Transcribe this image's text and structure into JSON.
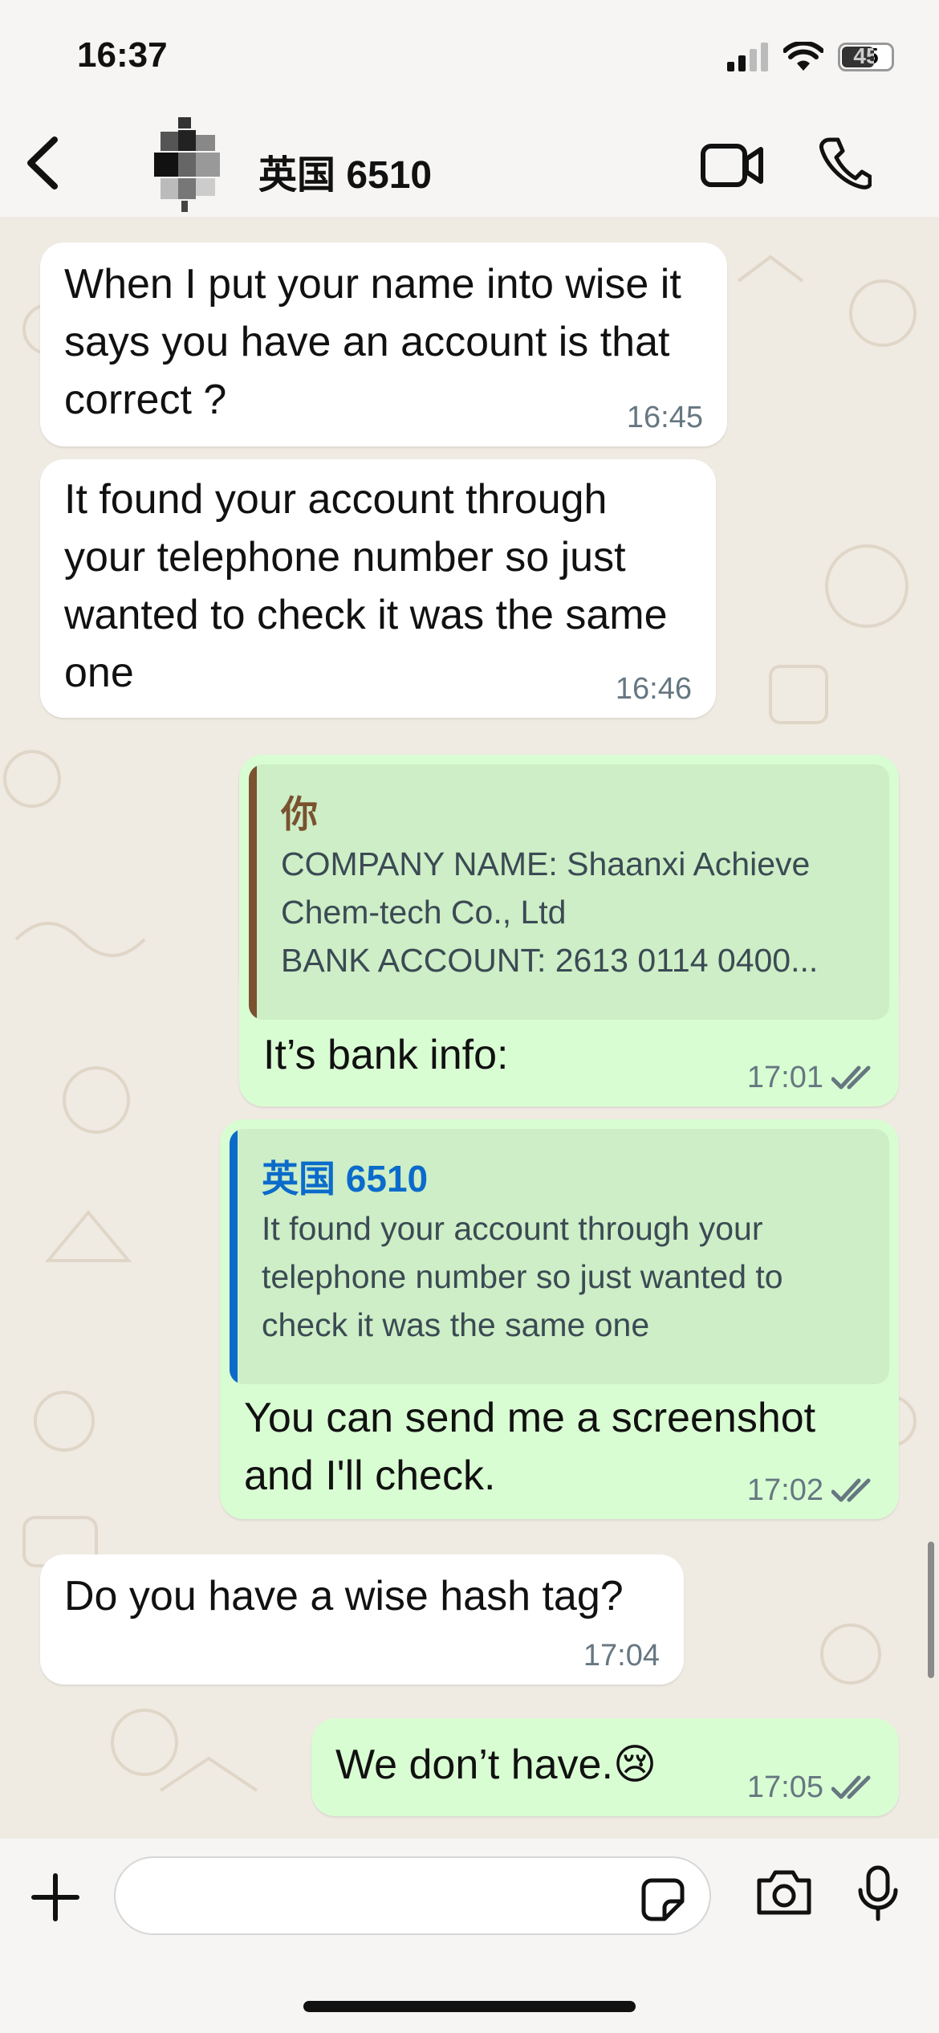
{
  "status_bar": {
    "time": "16:37",
    "battery": "45"
  },
  "header": {
    "contact_name": "英国 6510"
  },
  "messages": [
    {
      "dir": "in",
      "text": "When I put your name into wise it says you have an account is that correct ?",
      "time": "16:45"
    },
    {
      "dir": "in",
      "text": "It found your account through your telephone number so just wanted to check it was the same one",
      "time": "16:46"
    },
    {
      "dir": "out",
      "quote": {
        "author": "你",
        "lines": [
          "COMPANY NAME: Shaanxi Achieve",
          "Chem-tech Co., Ltd",
          "BANK ACCOUNT: 2613 0114 0400..."
        ]
      },
      "text": "It’s bank info:",
      "time": "17:01"
    },
    {
      "dir": "out",
      "quote": {
        "author": "英国 6510",
        "lines": [
          "It found your account through your",
          "telephone number so just wanted to",
          "check it was the same one"
        ]
      },
      "text": "You can send me a screenshot and I'll check.",
      "time": "17:02"
    },
    {
      "dir": "in",
      "text": "Do you have a wise hash tag?",
      "time": "17:04"
    },
    {
      "dir": "out",
      "text": "We don’t have.",
      "emoji": "😢",
      "time": "17:05"
    }
  ],
  "colors": {
    "chat_bg": "#efeae2",
    "incoming": "#ffffff",
    "outgoing": "#d9fdd3",
    "quote_self": "#7a5230",
    "quote_contact": "#0b6bcb",
    "read_ticks": "#667781"
  },
  "icons": [
    "back-icon",
    "video-call-icon",
    "voice-call-icon",
    "plus-icon",
    "sticker-icon",
    "camera-icon",
    "mic-icon",
    "scroll-down-icon"
  ]
}
